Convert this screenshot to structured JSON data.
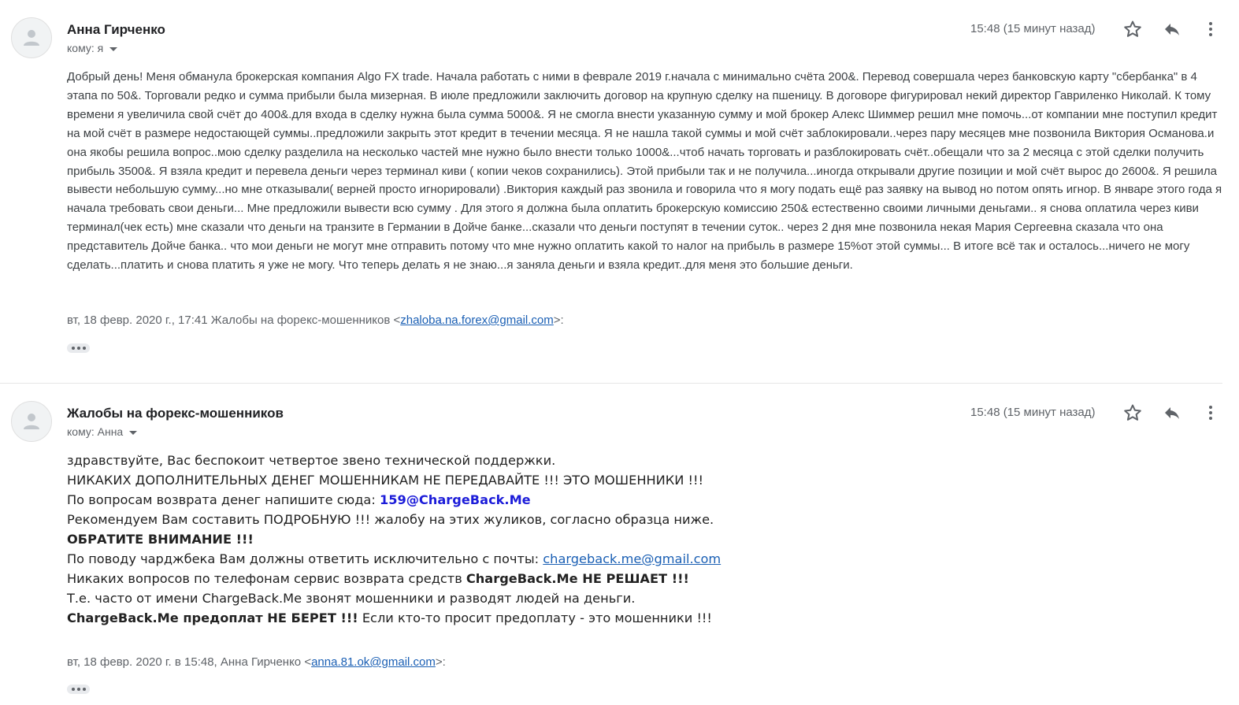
{
  "messages": [
    {
      "sender": "Анна Гирченко",
      "to_label": "кому: я",
      "time": "15:48 (15 минут назад)",
      "body": "Добрый день! Меня обманула брокерская компания Algo FX trade. Начала работать с ними в феврале 2019 г.начала с минимально счёта 200&. Перевод совершала через банковскую карту \"сбербанка\" в 4 этапа по 50&. Торговали редко и сумма прибыли была мизерная. В июле предложили заключить договор на крупную сделку на пшеницу. В договоре фигурировал некий директор Гавриленко Николай. К тому времени я увеличила свой счёт до 400&.для входа в сделку нужна была сумма 5000&. Я не смогла внести указанную сумму и мой брокер Алекс Шиммер решил мне помочь...от компании мне поступил кредит на мой счёт в размере недостающей суммы..предложили закрыть этот кредит в течении месяца. Я не нашла такой суммы и мой счёт заблокировали..через пару месяцев мне позвонила Виктория Османова.и она якобы решила вопрос..мою сделку разделила на несколько частей мне нужно было внести только 1000&...чтоб начать торговать и разблокировать счёт..обещали что за 2 месяца с этой сделки получить прибыль 3500&. Я взяла кредит и перевела деньги через терминал киви ( копии чеков сохранились). Этой прибыли так и не получила...иногда открывали другие позиции и мой счёт вырос до 2600&. Я решила вывести небольшую сумму...но мне отказывали( верней просто игнорировали) .Виктория каждый раз звонила и говорила что я могу подать ещё раз заявку на вывод но потом опять игнор. В январе этого года я начала требовать свои деньги... Мне предложили вывести всю сумму . Для этого я должна была оплатить брокерскую комиссию 250& естественно своими личными деньгами.. я снова оплатила через киви терминал(чек есть) мне сказали что деньги на транзите в Германии в Дойче банке...сказали что деньги поступят в течении суток.. через 2 дня мне позвонила некая Мария Сергеевна сказала что она представитель Дойче банка.. что мои деньги не могут мне отправить потому что мне нужно оплатить какой то налог на прибыль в размере 15%от этой суммы... В итоге всё так и осталось...ничего не могу сделать...платить и снова платить я уже не могу. Что теперь делать я не знаю...я заняла деньги и взяла кредит..для меня это большие деньги.",
      "quote_prefix": "вт, 18 февр. 2020 г., 17:41 Жалобы на форекс-мошенников <",
      "quote_email": "zhaloba.na.forex@gmail.com",
      "quote_suffix": ">:"
    },
    {
      "sender": "Жалобы на форекс-мошенников",
      "to_label": "кому: Анна",
      "time": "15:48 (15 минут назад)",
      "lines": {
        "l1": "здравствуйте, Вас беспокоит четвертое звено технической поддержки.",
        "l2": "НИКАКИХ ДОПОЛНИТЕЛЬНЫХ ДЕНЕГ МОШЕННИКАМ НЕ ПЕРЕДАВАЙТЕ !!! ЭТО МОШЕННИКИ !!!",
        "l3_text": "По вопросам возврата денег напишите сюда: ",
        "l3_email": "159@ChargeBack.Me",
        "l4": "Рекомендуем Вам составить ПОДРОБНУЮ !!! жалобу на этих жуликов, согласно образца ниже.",
        "l5": "ОБРАТИТЕ ВНИМАНИЕ !!!",
        "l6_text": "По поводу чарджбека Вам должны ответить исключительно с почты: ",
        "l6_email": "chargeback.me@gmail.com",
        "l7_text": "Никаких вопросов по телефонам сервис возврата средств ",
        "l7_bold": "ChargeBack.Me НЕ РЕШАЕТ !!!",
        "l8": "Т.е. часто от имени ChargeBack.Me звонят мошенники и разводят людей на деньги.",
        "l9_bold": "ChargeBack.Me предоплат НЕ БЕРЕТ !!!",
        "l9_text": " Если кто-то просит предоплату - это мошенники !!!"
      },
      "quote_prefix": "вт, 18 февр. 2020 г. в 15:48, Анна Гирченко <",
      "quote_email": "anna.81.ok@gmail.com",
      "quote_suffix": ">:"
    }
  ]
}
